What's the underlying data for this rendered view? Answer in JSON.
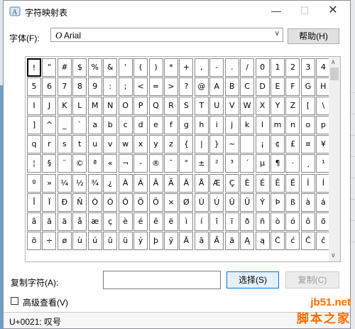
{
  "window": {
    "title": "字符映射表",
    "minimize_glyph": "—",
    "maximize_glyph": "☐",
    "close_glyph": "✕"
  },
  "font_picker": {
    "label": "字体(F):",
    "value": "Arial",
    "font_icon_glyph": "O",
    "dropdown_glyph": "∨"
  },
  "help_button": "帮助(H)",
  "characters": [
    "!",
    "\"",
    "#",
    "$",
    "%",
    "&",
    "'",
    "(",
    ")",
    "*",
    "+",
    ",",
    "-",
    ".",
    "/",
    "0",
    "1",
    "2",
    "3",
    "4",
    "5",
    "6",
    "7",
    "8",
    "9",
    ":",
    ";",
    "<",
    "=",
    ">",
    "?",
    "@",
    "A",
    "B",
    "C",
    "D",
    "E",
    "F",
    "G",
    "H",
    "I",
    "J",
    "K",
    "L",
    "M",
    "N",
    "O",
    "P",
    "Q",
    "R",
    "S",
    "T",
    "U",
    "V",
    "W",
    "X",
    "Y",
    "Z",
    "[",
    "\\",
    "]",
    "^",
    "_",
    "`",
    "a",
    "b",
    "c",
    "d",
    "e",
    "f",
    "g",
    "h",
    "i",
    "j",
    "k",
    "l",
    "m",
    "n",
    "o",
    "p",
    "q",
    "r",
    "s",
    "t",
    "u",
    "v",
    "w",
    "x",
    "y",
    "z",
    "{",
    "|",
    "}",
    "~",
    " ",
    "¡",
    "¢",
    "£",
    "¤",
    "¥",
    "¦",
    "§",
    "¨",
    "©",
    "ª",
    "«",
    "¬",
    "-",
    "®",
    "¯",
    "°",
    "±",
    "²",
    "³",
    "´",
    "µ",
    "¶",
    "·",
    "¸",
    "¹",
    "º",
    "»",
    "¼",
    "½",
    "¾",
    "¿",
    "À",
    "Á",
    "Â",
    "Ã",
    "Ä",
    "Å",
    "Æ",
    "Ç",
    "È",
    "É",
    "Ê",
    "Ë",
    "Ì",
    "Í",
    "Î",
    "Ï",
    "Ð",
    "Ñ",
    "Ò",
    "Ó",
    "Ô",
    "Õ",
    "Ö",
    "×",
    "Ø",
    "Ù",
    "Ú",
    "Û",
    "Ü",
    "Ý",
    "Þ",
    "ß",
    "à",
    "á",
    "â",
    "ã",
    "ä",
    "å",
    "æ",
    "ç",
    "è",
    "é",
    "ê",
    "ë",
    "ì",
    "í",
    "î",
    "ï",
    "ð",
    "ñ",
    "ò",
    "ó",
    "ô",
    "õ",
    "ö",
    "÷",
    "ø",
    "ù",
    "ú",
    "û",
    "ü",
    "ý",
    "þ",
    "ÿ",
    "Ā",
    "ā",
    "Ă",
    "ă",
    "Ą",
    "ą",
    "Ć",
    "ć",
    "Ĉ",
    "ĉ"
  ],
  "selected_index": 0,
  "scrollbar": {
    "up_glyph": "∧",
    "down_glyph": "∨"
  },
  "copy_row": {
    "label": "复制字符(A):",
    "value": "",
    "select_button": "选择(S)",
    "copy_button": "复制(C)"
  },
  "advanced_view": {
    "label": "高级查看(V)",
    "checked": false
  },
  "status_text": "U+0021: 叹号",
  "watermark": {
    "line1": "jb51.net",
    "line2": "脚本之家"
  }
}
